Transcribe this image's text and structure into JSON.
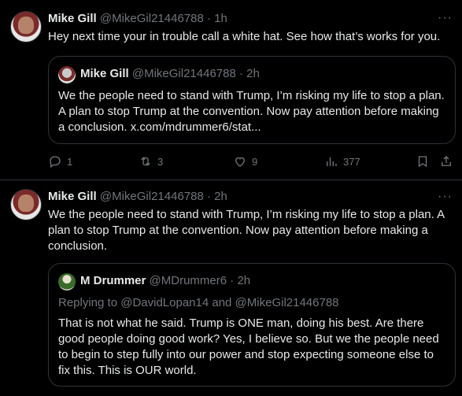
{
  "tweet1": {
    "name": "Mike Gill",
    "handle": "@MikeGil21446788",
    "dot": "·",
    "time": "1h",
    "more": "···",
    "text": "Hey next time your in trouble call a white hat. See how that’s works for you.",
    "quote": {
      "name": "Mike Gill",
      "handle": "@MikeGil21446788",
      "dot": "·",
      "time": "2h",
      "text": "We the people need to stand with Trump, I’m risking my life to stop a plan. A plan to stop Trump at the convention.  Now pay attention before making a conclusion. x.com/mdrummer6/stat..."
    },
    "actions": {
      "replies": "1",
      "reposts": "3",
      "likes": "9",
      "views": "377"
    }
  },
  "tweet2": {
    "name": "Mike Gill",
    "handle": "@MikeGil21446788",
    "dot": "·",
    "time": "2h",
    "more": "···",
    "text": "We the people need to stand with Trump, I’m risking my life to stop a plan. A plan to stop Trump at the convention.  Now pay attention before making a conclusion.",
    "quote": {
      "name": "M Drummer",
      "handle": "@MDrummer6",
      "dot": "·",
      "time": "2h",
      "replying": "Replying to @DavidLopan14 and @MikeGil21446788",
      "text": "That is not what he said. Trump is ONE man, doing his best. Are there good people doing good work? Yes, I believe so. But we the people need to begin to step fully into our power and stop expecting someone else to fix this. This is OUR world."
    }
  }
}
